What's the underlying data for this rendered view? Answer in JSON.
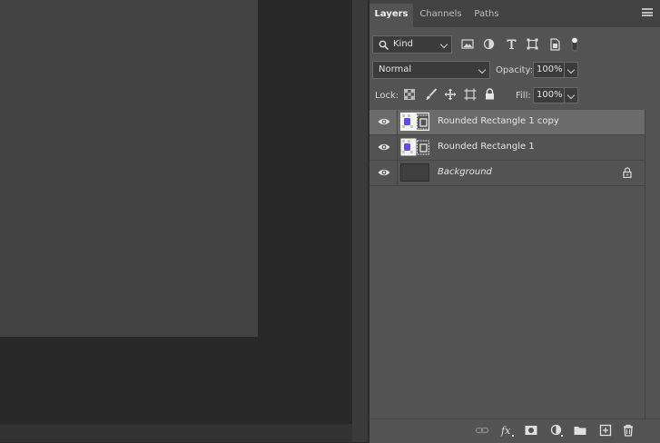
{
  "panel": {
    "tabs": [
      {
        "label": "Layers",
        "active": true
      },
      {
        "label": "Channels",
        "active": false
      },
      {
        "label": "Paths",
        "active": false
      }
    ],
    "filter": {
      "value": "Kind"
    },
    "filter_icons": [
      "image-filter-icon",
      "adjustment-filter-icon",
      "type-filter-icon",
      "shape-filter-icon",
      "smart-object-filter-icon",
      "filter-toggle-icon"
    ],
    "blend_mode": "Normal",
    "opacity_label": "Opacity:",
    "opacity_value": "100%",
    "lock_label": "Lock:",
    "lock_icons": [
      "lock-transparent-pixels-icon",
      "lock-image-pixels-icon",
      "lock-position-icon",
      "lock-artboard-icon",
      "lock-all-icon"
    ],
    "fill_label": "Fill:",
    "fill_value": "100%"
  },
  "layers": [
    {
      "name": "Rounded Rectangle 1 copy",
      "selected": true,
      "visible": true,
      "italic": false,
      "locked": false,
      "type": "shape"
    },
    {
      "name": "Rounded Rectangle 1",
      "selected": false,
      "visible": true,
      "italic": false,
      "locked": false,
      "type": "shape"
    },
    {
      "name": "Background",
      "selected": false,
      "visible": true,
      "italic": true,
      "locked": true,
      "type": "background"
    }
  ],
  "footer_buttons": [
    "link-layers-icon",
    "fx-icon",
    "add-mask-icon",
    "new-adjustment-icon",
    "new-group-icon",
    "new-layer-icon",
    "delete-layer-icon"
  ],
  "colors": {
    "panel_bg": "#535353",
    "selected_row": "#6b6b6b",
    "canvas_bg": "#282828",
    "document_bg": "#434243",
    "thumb_accent": "#5a4bff"
  }
}
